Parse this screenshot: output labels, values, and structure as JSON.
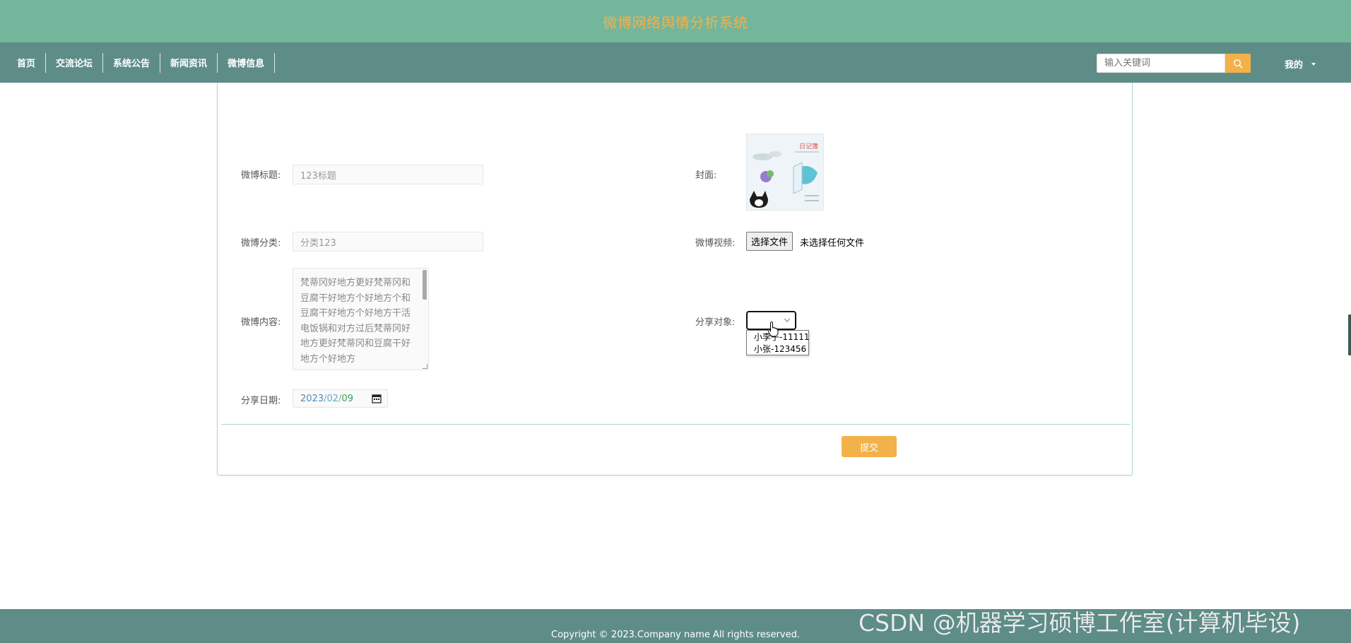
{
  "header": {
    "site_title": "微博网络舆情分析系统"
  },
  "nav": {
    "items": [
      {
        "label": "首页"
      },
      {
        "label": "交流论坛"
      },
      {
        "label": "系统公告"
      },
      {
        "label": "新闻资讯"
      },
      {
        "label": "微博信息"
      }
    ],
    "search": {
      "placeholder": "输入关键词",
      "icon": "search-icon"
    },
    "mine_label": "我的"
  },
  "form": {
    "title": {
      "label": "微博标题:",
      "value": "123标题"
    },
    "category": {
      "label": "微博分类:",
      "value": "分类123"
    },
    "content": {
      "label": "微博内容:",
      "value": "梵蒂冈好地方更好梵蒂冈和豆腐干好地方个好地方个和豆腐干好地方个好地方干活电饭锅和对方过后梵蒂冈好地方更好梵蒂冈和豆腐干好地方个好地方"
    },
    "share_date": {
      "label": "分享日期:",
      "year": "2023",
      "month": "02",
      "day": "09",
      "sep": "/"
    },
    "cover": {
      "label": "封面:"
    },
    "video": {
      "label": "微博视频:",
      "button_label": "选择文件",
      "status": "未选择任何文件"
    },
    "share_target": {
      "label": "分享对象:",
      "selected": "",
      "options": [
        "小李子-11111",
        "小张-123456"
      ]
    },
    "submit_label": "提交"
  },
  "footer": {
    "copyright": "Copyright © 2023.Company name All rights reserved."
  },
  "watermark": "CSDN @机器学习硕博工作室(计算机毕设)",
  "colors": {
    "title_bar": "#74b69b",
    "nav_bar": "#5e8d88",
    "accent": "#f3b14a"
  }
}
